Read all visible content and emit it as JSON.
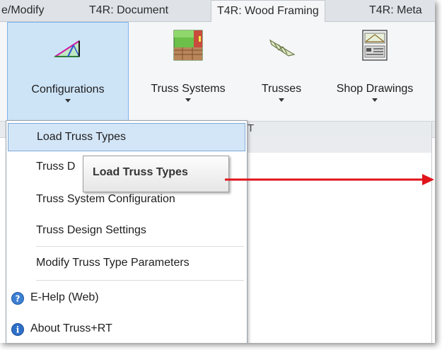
{
  "tabs": [
    {
      "label": "e/Modify"
    },
    {
      "label": "T4R: Document"
    },
    {
      "label": "T4R: Wood Framing"
    },
    {
      "label": "T4R: Meta"
    }
  ],
  "ribbon": {
    "buttons": [
      {
        "label": "Configurations",
        "icon": "configuration-truss-icon"
      },
      {
        "label": "Truss Systems",
        "icon": "truss-system-icon"
      },
      {
        "label": "Trusses",
        "icon": "truss-icon"
      },
      {
        "label": "Shop Drawings",
        "icon": "shop-drawing-icon"
      }
    ],
    "panel_fragment": "T"
  },
  "menu": {
    "items": [
      {
        "label": "Load Truss Types"
      },
      {
        "label": "Truss D"
      },
      {
        "label": "Truss System Configuration"
      },
      {
        "label": "Truss Design Settings"
      },
      {
        "label": "Modify Truss Type Parameters"
      },
      {
        "label": "E-Help (Web)",
        "icon": "help-icon"
      },
      {
        "label": "About Truss+RT",
        "icon": "info-icon"
      }
    ]
  },
  "tooltip": {
    "text": "Load Truss Types"
  },
  "colors": {
    "highlight": "#d3e6f8",
    "pressed": "#cde4f7",
    "arrow": "#e0141b"
  }
}
